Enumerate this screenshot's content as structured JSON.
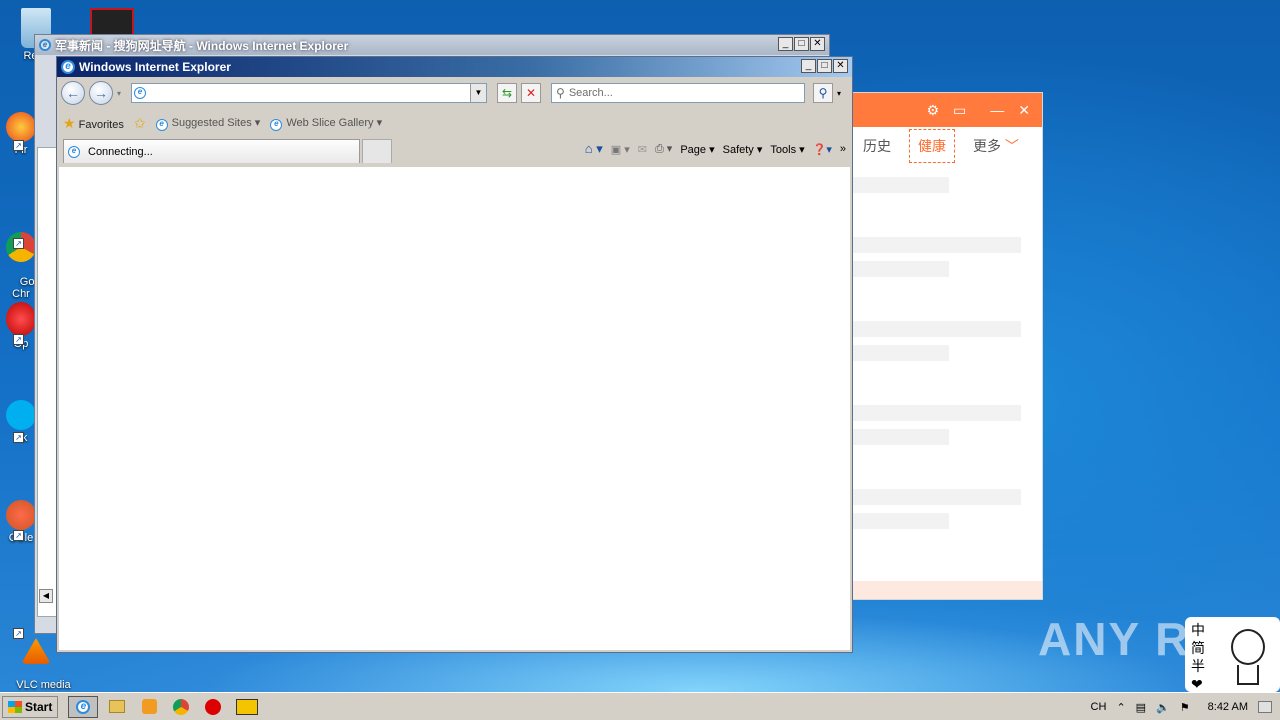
{
  "desktop": {
    "icons": [
      {
        "label": "Recy",
        "icon": "recycle-bin-icon"
      },
      {
        "label": "Fir",
        "icon": "firefox-icon"
      },
      {
        "label": "Go\nChr",
        "icon": "chrome-icon"
      },
      {
        "label": "Op",
        "icon": "opera-icon"
      },
      {
        "label": "Sk",
        "icon": "skype-icon"
      },
      {
        "label": "CCle",
        "icon": "ccleaner-icon"
      },
      {
        "label": "VLC media\nplayer",
        "icon": "vlc-icon"
      }
    ]
  },
  "back_window": {
    "title": "军事新闻 - 搜狗网址导航 - Windows Internet Explorer"
  },
  "side_app": {
    "tabs": [
      "历史",
      "健康",
      "更多"
    ],
    "active_tab": "健康"
  },
  "ie_window": {
    "title": "Windows Internet Explorer",
    "address_value": "",
    "search_placeholder": "Search...",
    "favorites_label": "Favorites",
    "suggested_sites_label": "Suggested Sites",
    "web_slice_label": "Web Slice Gallery",
    "tab_label": "Connecting...",
    "page_menu": "Page",
    "safety_menu": "Safety",
    "tools_menu": "Tools"
  },
  "watermark": "ANY RUN",
  "ime_chars": [
    "中",
    "简",
    "半",
    "❤"
  ],
  "taskbar": {
    "start_label": "Start",
    "language": "CH",
    "clock": "8:42 AM"
  },
  "colors": {
    "accent_orange": "#ff7a3c",
    "ie_title_blue": "#0a246a",
    "taskbar": "#d4d0c8"
  }
}
